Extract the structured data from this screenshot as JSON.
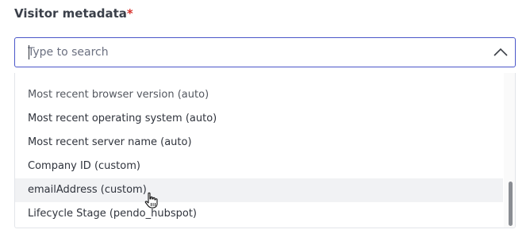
{
  "field": {
    "label": "Visitor metadata",
    "required_marker": "*"
  },
  "search": {
    "placeholder": "Type to search",
    "value": ""
  },
  "dropdown": {
    "expanded": true,
    "options": [
      {
        "label": "Most recent browser version (auto)",
        "hovered": false
      },
      {
        "label": "Most recent operating system (auto)",
        "hovered": false
      },
      {
        "label": "Most recent server name (auto)",
        "hovered": false
      },
      {
        "label": "Company ID (custom)",
        "hovered": false
      },
      {
        "label": "emailAddress (custom)",
        "hovered": true
      },
      {
        "label": "Lifecycle Stage (pendo_hubspot)",
        "hovered": false
      }
    ]
  },
  "icons": {
    "toggle": "chevron-up-icon",
    "pointer": "hand-pointer-icon"
  },
  "colors": {
    "focus_border": "#4a56c9",
    "required": "#d7332d",
    "hover_bg": "#f1f2f4",
    "text": "#2f333c"
  }
}
